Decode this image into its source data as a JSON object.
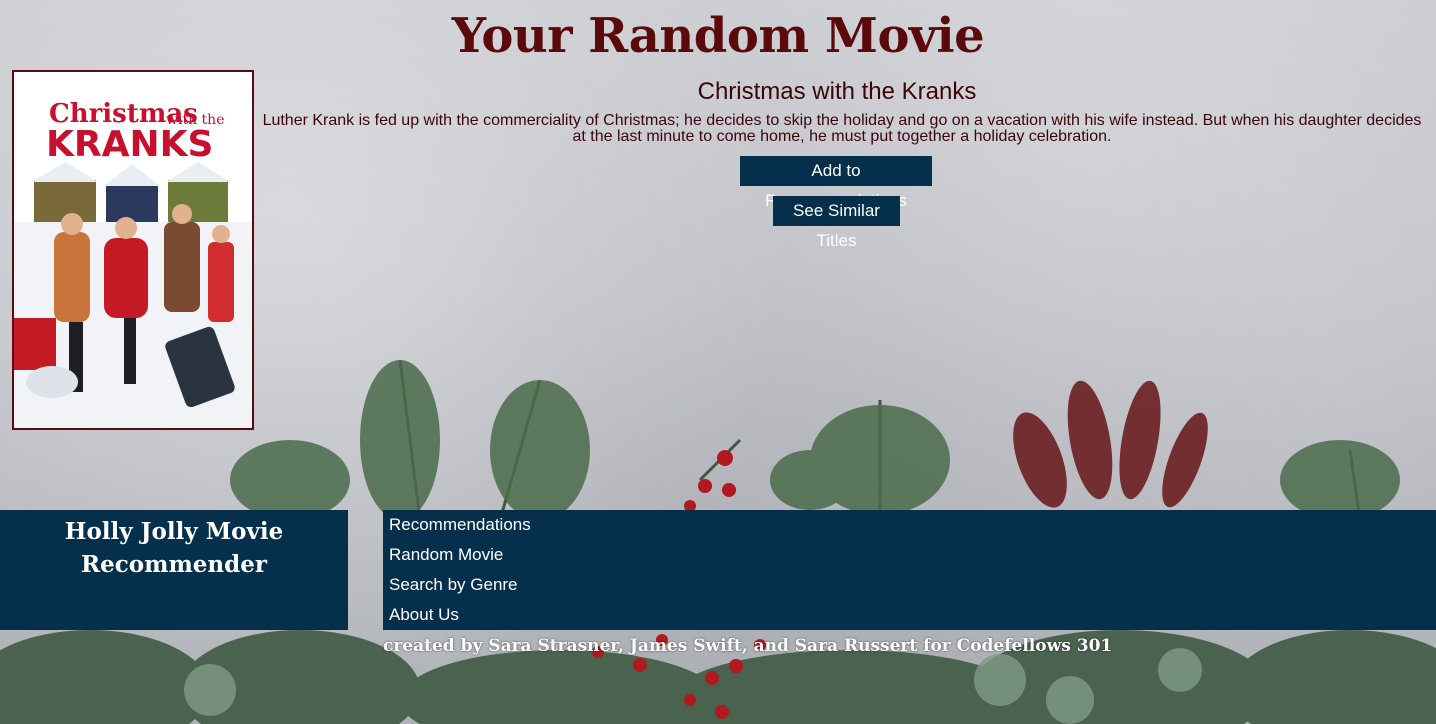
{
  "header": {
    "title": "Your Random Movie"
  },
  "movie": {
    "poster_title_line1": "Christmas",
    "poster_title_line2": "with the",
    "poster_title_line3": "KRANKS",
    "title": "Christmas with the Kranks",
    "overview": "Luther Krank is fed up with the commerciality of Christmas; he decides to skip the holiday and go on a vacation with his wife instead. But when his daughter decides at the last minute to come home, he must put together a holiday celebration."
  },
  "actions": {
    "add_label": "Add to Recommendations",
    "similar_label": "See Similar Titles"
  },
  "footer": {
    "brand": "Holly Jolly Movie Recommender",
    "nav": [
      "Recommendations",
      "Random Movie",
      "Search by Genre",
      "About Us"
    ],
    "credit": "created by Sara Strasner, James Swift, and Sara Russert for Codefellows 301"
  },
  "colors": {
    "title": "#5a0a0a",
    "navy": "#062f4c",
    "text": "#3a0508"
  }
}
